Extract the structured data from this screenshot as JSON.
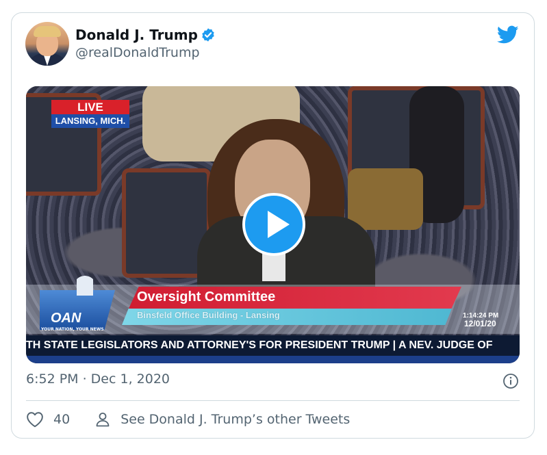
{
  "tweet": {
    "author_name": "Donald J. Trump",
    "author_handle": "@realDonaldTrump",
    "timestamp": "6:52 PM · Dec 1, 2020",
    "likes": "40",
    "other_tweets_link": "See Donald J. Trump’s other Tweets"
  },
  "video": {
    "live_label": "LIVE",
    "location_label": "LANSING, MICH.",
    "network_logo": "OAN",
    "network_tagline": "YOUR NATION, YOUR NEWS",
    "lower_third_title": "Oversight Committee",
    "lower_third_subtitle": "Binsfeld Office Building - Lansing",
    "broadcast_time": "1:14:24 PM",
    "broadcast_date": "12/01/20",
    "ticker": "TH STATE LEGISLATORS AND ATTORNEY'S FOR PRESIDENT TRUMP  |  A NEV. JUDGE OF"
  },
  "icons": {
    "verified": "verified-badge-icon",
    "bird": "twitter-bird-icon",
    "play": "play-icon",
    "info": "info-icon",
    "heart": "heart-icon",
    "person": "person-icon"
  },
  "colors": {
    "accent": "#1d9bf0",
    "secondary_text": "#536471",
    "border": "#cfd9de"
  }
}
